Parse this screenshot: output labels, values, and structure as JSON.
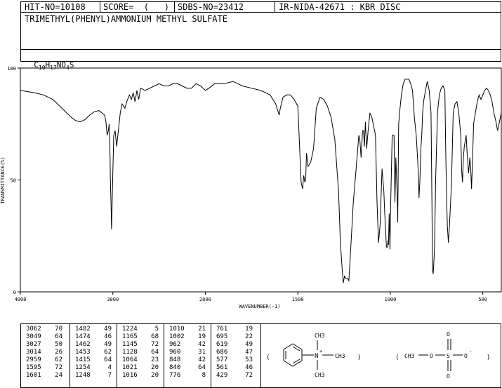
{
  "header": {
    "hit_no": "HIT-NO=10108",
    "score": "SCORE=  (   )",
    "sdbs_no": "SDBS-NO=23412",
    "ir_nida": "IR-NIDA-42671 : KBR DISC",
    "compound_name": "TRIMETHYL(PHENYL)AMMONIUM METHYL SULFATE",
    "formula_parts": [
      "C",
      "10",
      "H",
      "17",
      "NO",
      "4",
      "S"
    ]
  },
  "chart_data": {
    "type": "line",
    "xlabel": "WAVENUMBER(-1)",
    "ylabel": "TRANSMITTANCE(%)",
    "xlim": [
      4000,
      400
    ],
    "ylim": [
      0,
      100
    ],
    "xticks": [
      4000,
      3000,
      2000,
      1500,
      1000,
      500
    ],
    "yticks": [
      0,
      50,
      100
    ],
    "grid": false,
    "series": [
      {
        "x": [
          4000,
          3850,
          3750,
          3650,
          3550,
          3450,
          3400,
          3350,
          3300,
          3250,
          3200,
          3150,
          3120,
          3090,
          3075,
          3062,
          3049,
          3040,
          3030,
          3027,
          3020,
          3014,
          3005,
          2990,
          2975,
          2959,
          2940,
          2920,
          2900,
          2870,
          2850,
          2820,
          2800,
          2780,
          2760,
          2740,
          2720,
          2700,
          2650,
          2600,
          2550,
          2500,
          2450,
          2400,
          2350,
          2300,
          2250,
          2200,
          2150,
          2100,
          2050,
          2000,
          1980,
          1950,
          1900,
          1850,
          1800,
          1750,
          1700,
          1650,
          1620,
          1601,
          1595,
          1580,
          1560,
          1540,
          1520,
          1500,
          1482,
          1474,
          1468,
          1462,
          1458,
          1453,
          1445,
          1430,
          1415,
          1400,
          1380,
          1360,
          1340,
          1320,
          1300,
          1280,
          1270,
          1260,
          1254,
          1248,
          1240,
          1230,
          1224,
          1215,
          1200,
          1190,
          1180,
          1170,
          1165,
          1158,
          1150,
          1145,
          1140,
          1135,
          1128,
          1120,
          1110,
          1100,
          1090,
          1080,
          1072,
          1064,
          1055,
          1045,
          1035,
          1030,
          1021,
          1016,
          1012,
          1010,
          1006,
          1002,
          998,
          990,
          980,
          975,
          970,
          962,
          960,
          955,
          950,
          940,
          930,
          920,
          910,
          900,
          890,
          880,
          870,
          860,
          853,
          848,
          845,
          840,
          835,
          830,
          825,
          820,
          810,
          800,
          790,
          780,
          775,
          772,
          768,
          761,
          755,
          745,
          735,
          725,
          715,
          705,
          700,
          695,
          692,
          686,
          680,
          670,
          660,
          650,
          640,
          630,
          619,
          615,
          610,
          605,
          600,
          590,
          585,
          577,
          570,
          565,
          561,
          555,
          550,
          540,
          530,
          520,
          510,
          500,
          490,
          480,
          470,
          460,
          450,
          440,
          429,
          420,
          410,
          400
        ],
        "y": [
          90,
          89,
          88,
          86,
          82,
          78,
          76.5,
          76,
          77,
          79,
          80.5,
          81,
          80,
          79,
          76,
          70,
          72,
          75,
          60,
          50,
          40,
          28,
          45,
          70,
          72,
          65,
          72,
          80,
          84,
          82,
          85,
          88,
          86,
          89,
          85,
          90,
          86,
          91,
          90,
          91,
          92,
          93,
          92,
          92,
          93,
          93,
          92,
          91,
          91,
          93,
          92,
          90,
          91,
          93,
          93,
          94,
          92,
          91,
          90,
          88,
          84,
          79,
          82,
          87,
          88,
          88,
          86,
          83,
          49,
          46,
          52,
          49,
          50,
          62,
          56,
          58,
          64,
          82,
          87,
          86,
          83,
          78,
          68,
          45,
          22,
          10,
          4,
          7,
          6,
          6,
          5,
          18,
          40,
          50,
          60,
          70,
          68,
          60,
          72,
          72,
          65,
          76,
          64,
          72,
          80,
          78,
          74,
          70,
          40,
          22,
          30,
          55,
          45,
          35,
          20,
          20,
          23,
          21,
          35,
          19,
          40,
          70,
          70,
          40,
          60,
          42,
          31,
          75,
          80,
          88,
          93,
          95,
          95,
          95,
          93,
          90,
          78,
          70,
          60,
          52,
          42,
          50,
          64,
          70,
          80,
          85,
          90,
          94,
          90,
          80,
          40,
          10,
          8,
          19,
          50,
          80,
          88,
          91,
          92,
          90,
          60,
          40,
          30,
          22,
          30,
          47,
          80,
          84,
          85,
          80,
          70,
          55,
          49,
          60,
          65,
          70,
          62,
          53,
          60,
          55,
          46,
          60,
          75,
          80,
          85,
          88,
          86,
          88,
          90,
          91,
          90,
          88,
          85,
          80,
          76,
          72,
          76,
          80
        ]
      }
    ],
    "peaks_table": [
      [
        "3062",
        "70",
        "1482",
        "49",
        "1224",
        "5",
        "1010",
        "21",
        "761",
        "19"
      ],
      [
        "3049",
        "64",
        "1474",
        "46",
        "1165",
        "68",
        "1002",
        "19",
        "695",
        "22"
      ],
      [
        "3027",
        "50",
        "1462",
        "49",
        "1145",
        "72",
        "962",
        "42",
        "619",
        "49"
      ],
      [
        "3014",
        "26",
        "1453",
        "62",
        "1128",
        "64",
        "960",
        "31",
        "686",
        "47"
      ],
      [
        "2959",
        "62",
        "1415",
        "64",
        "1064",
        "23",
        "848",
        "42",
        "577",
        "53"
      ],
      [
        "1595",
        "72",
        "1254",
        "4",
        "1021",
        "20",
        "840",
        "64",
        "561",
        "46"
      ],
      [
        "1601",
        "24",
        "1248",
        "7",
        "1016",
        "20",
        "776",
        "8",
        "429",
        "72"
      ]
    ]
  },
  "structure": {
    "paren_open": "(",
    "paren_close": ")",
    "cation_methyls": [
      "CH3",
      "CH3",
      "CH3"
    ],
    "cation_charge": "+",
    "anion_ch3": "CH3",
    "anion_o": "O",
    "anion_s": "S",
    "anion_o_top": "O",
    "anion_o_bottom": "O",
    "anion_o_minus": "O",
    "anion_charge": "-"
  }
}
